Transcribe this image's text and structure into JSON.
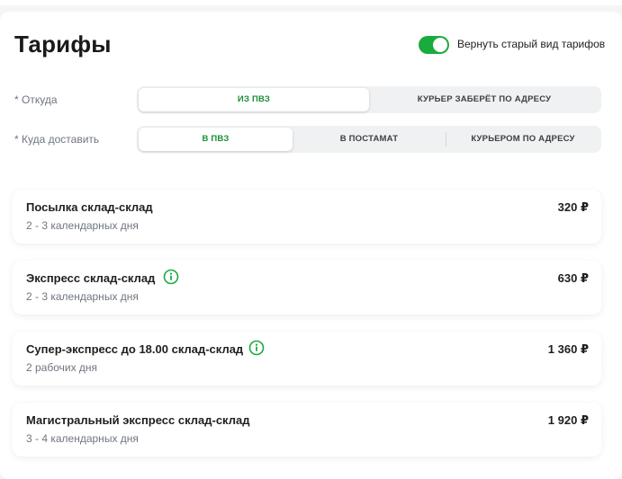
{
  "header": {
    "title": "Тарифы",
    "toggle": {
      "label": "Вернуть старый вид тарифов",
      "on": true,
      "color": "#1aab3f"
    }
  },
  "from": {
    "label": "* Откуда",
    "options": [
      "из ПВЗ",
      "Курьер заберёт по адресу"
    ],
    "selected": "из ПВЗ"
  },
  "to": {
    "label": "* Куда доставить",
    "options": [
      "в ПВЗ",
      "в постамат",
      "Курьером по адресу"
    ],
    "selected": "в ПВЗ"
  },
  "tariffs": [
    {
      "name": "Посылка склад-склад",
      "days": "2 - 3 календарных дня",
      "price": "320 ₽",
      "info_icon": false
    },
    {
      "name": "Экспресс склад-склад",
      "days": "2 - 3 календарных дня",
      "price": "630 ₽",
      "info_icon": true
    },
    {
      "name": "Супер-экспресс до 18.00 склад-склад",
      "days": "2 рабочих дня",
      "price": "1 360 ₽",
      "info_icon": true
    },
    {
      "name": "Магистральный экспресс склад-склад",
      "days": "3 - 4 календарных дня",
      "price": "1 920 ₽",
      "info_icon": false
    }
  ],
  "colors": {
    "accent": "#1aab3f",
    "active_text": "#1a8e3a",
    "muted_text": "#6f7680"
  }
}
